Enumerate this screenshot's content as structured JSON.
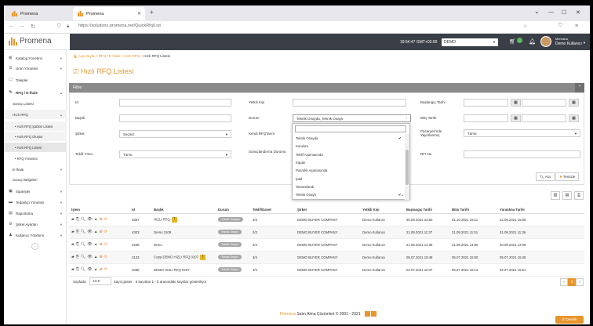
{
  "browser": {
    "tabs": [
      {
        "label": "Promena"
      },
      {
        "label": "Promena"
      }
    ],
    "new_tab": "+",
    "url": "https://solutions.promena.net/QuickRfq/List"
  },
  "header": {
    "logo_text": "Promena",
    "time": "19:54:47 GMT+03:00",
    "company": "DEMO",
    "user_greeting": "Merhaba,",
    "user_name": "Demo Kullanıcı"
  },
  "sidebar": {
    "items": [
      {
        "label": "Katalog Yönetimi"
      },
      {
        "label": "Ürün Yönetimi"
      },
      {
        "label": "Talepler"
      },
      {
        "label": "RFQ / E-İhale"
      },
      {
        "label": "Sonuç Listesi"
      },
      {
        "label": "Hızlı RFQ"
      },
      {
        "label": "• Hızlı RFQ Şablon Listesi"
      },
      {
        "label": "• Hızlı RFQ Oluştur"
      },
      {
        "label": "• Hızlı RFQ Listesi"
      },
      {
        "label": "• RFQ Yönetimi"
      },
      {
        "label": "E-İhale"
      },
      {
        "label": "Sonuç Belgeleri"
      },
      {
        "label": "Siparişler"
      },
      {
        "label": "Tedarikçi Yönetimi"
      },
      {
        "label": "Raporlama"
      },
      {
        "label": "Şirket Ayarları"
      },
      {
        "label": "Kullanıcı Yönetimi"
      }
    ]
  },
  "breadcrumb": {
    "home": "Ana Sayfa",
    "sep": ">",
    "c1": "RFQ / E-İhale",
    "c2": "Hızlı RFQ",
    "current": "Hızlı RFQ Listesi"
  },
  "page_title": "Hızlı RFQ Listesi",
  "filter": {
    "title": "Filtre",
    "labels": {
      "id": "Id",
      "yetkili": "Yetkili Kişi",
      "baslangic": "Başlangıç Tarihi",
      "baslik": "Başlık",
      "durum": "Durum",
      "bitis": "Bitiş Tarihi",
      "sirket": "Şirket",
      "kendi": "Kendi RFQ'larım",
      "pazaryeri": "Pazaryeri'nde Yayınlanmış",
      "teklif": "Teklif Yönü",
      "sonuc": "Sonuçlandırma Durumu",
      "rfqno": "RFI No"
    },
    "sirket_value": "Seçiniz",
    "durum_value": "Teknik Onayda, Teknik Onaylı",
    "pazaryeri_value": "Tümü",
    "teklif_value": "Tümü",
    "ara": "Ara",
    "temizle": "Temizle"
  },
  "durum_options": [
    {
      "label": "Teknik Onayda",
      "checked": "✔"
    },
    {
      "label": "Kurulum",
      "checked": ""
    },
    {
      "label": "Teklif Aşamasında",
      "checked": ""
    },
    {
      "label": "Kapalı",
      "checked": ""
    },
    {
      "label": "Pazarlık Aşamasında",
      "checked": ""
    },
    {
      "label": "İptal",
      "checked": ""
    },
    {
      "label": "Tamamlandı",
      "checked": ""
    },
    {
      "label": "Teknik Onaylı",
      "checked": "✔"
    }
  ],
  "table": {
    "columns": [
      "İşlem",
      "Id",
      "Başlık",
      "Durum",
      "Teklif/Davet",
      "Şirket",
      "Yetkili Kişi",
      "Başlangıç Tarihi",
      "Bitiş Tarihi",
      "Yaratılma Tarihi"
    ],
    "rows": [
      {
        "id": "4357",
        "baslik": "HIZLI RFQ",
        "warn": true,
        "durum": "Teknik Onayda",
        "davet": "3/4",
        "sirket": "DEMO BUYER COMPANY",
        "yetkili": "Demo Kullanıcı",
        "baslangic": "30.09.2021 23:50",
        "bitis": "01.10.2021 19:11",
        "yaratilma": "22.09.2021 15:58"
      },
      {
        "id": "4303",
        "baslik": "Demo 2109",
        "warn": false,
        "durum": "Teknik Onaylı",
        "davet": "2/2",
        "sirket": "DEMO BUYER COMPANY",
        "yetkili": "Demo Kullanıcı",
        "baslangic": "21.09.2021 11:37",
        "bitis": "21.09.2021 11:51",
        "yaratilma": "21.09.2021 11:36"
      },
      {
        "id": "4269",
        "baslik": "demo",
        "warn": false,
        "durum": "Teknik Onaylı",
        "davet": "2/2",
        "sirket": "DEMO BUYER COMPANY",
        "yetkili": "Demo Kullanıcı",
        "baslangic": "21.09.2021 14:36",
        "bitis": "21.09.2021 14:50",
        "yaratilma": "20.09.2021 12:05"
      },
      {
        "id": "2133",
        "baslik": "Copy-DEMO HIZLI RFQ 0207",
        "warn": true,
        "durum": "Teknik Onaylı",
        "davet": "3/4",
        "sirket": "DEMO BUYER COMPANY",
        "yetkili": "Demo Kullanıcı",
        "baslangic": "05.07.2021 15:48",
        "bitis": "05.07.2021 15:50",
        "yaratilma": "05.07.2021 15:45"
      },
      {
        "id": "2089",
        "baslik": "DEMO HIZLI RFQ 0207",
        "warn": false,
        "durum": "Teknik Onaylı",
        "davet": "3/4",
        "sirket": "DEMO BUYER COMPANY",
        "yetkili": "Demo Kullanıcı",
        "baslangic": "04.07.2021 10:37",
        "bitis": "05.07.2021 15:13",
        "yaratilma": "02.07.2021 15:51"
      }
    ]
  },
  "pager": {
    "prefix": "Sayfada",
    "size": "10",
    "kayit": "kayıt göster",
    "info": "5 kayıttan 1 - 5 arasındaki kayıtlar gösteriliyor",
    "prev": "‹",
    "page": "1",
    "next": "›"
  },
  "footer": {
    "brand": "Promena",
    "text": "Satın Alma Çözümleri © 2001 - 2021"
  },
  "destek": "Destek",
  "colors": {
    "accent": "#e8952b",
    "topnav": "#3a3f47"
  }
}
